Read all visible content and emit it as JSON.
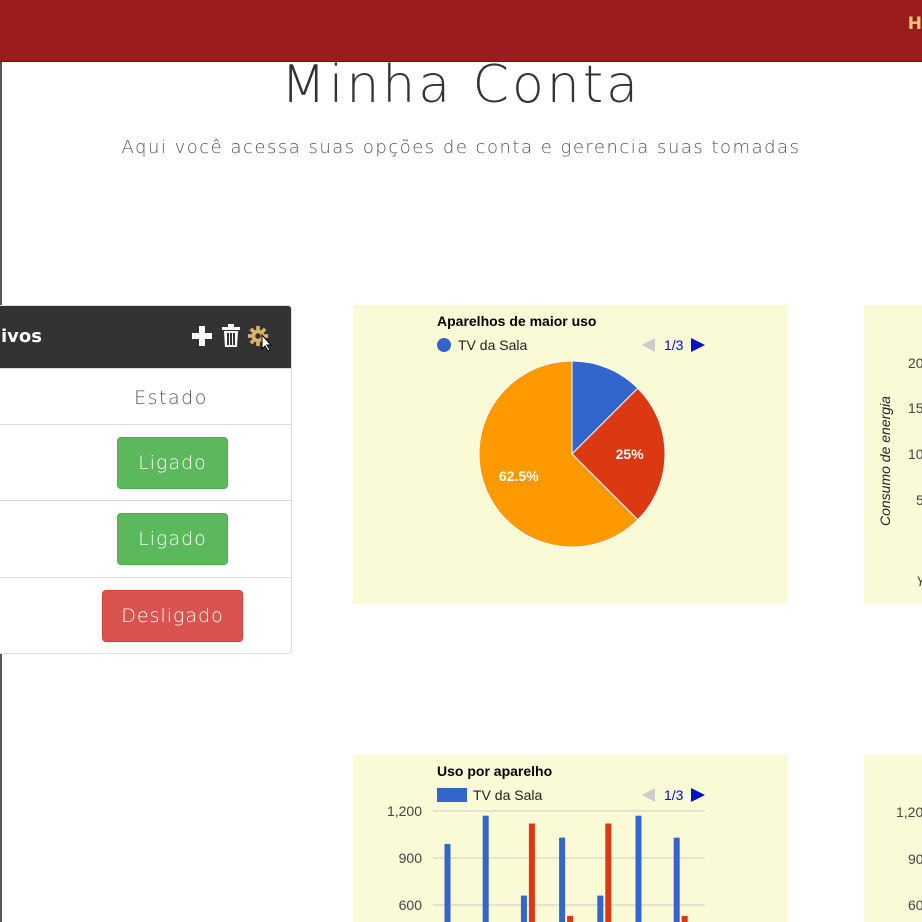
{
  "header": {
    "nav_text": "H"
  },
  "page": {
    "title": "Minha Conta",
    "subtitle": "Aqui você acessa suas opções de conta e gerencia suas tomadas"
  },
  "devices": {
    "title": "ivos",
    "column_state": "Estado",
    "rows": [
      {
        "state_label": "Ligado",
        "state": "on",
        "color": "#5cb85c"
      },
      {
        "state_label": "Ligado",
        "state": "on",
        "color": "#5cb85c"
      },
      {
        "state_label": "Desligado",
        "state": "off",
        "color": "#d9534f"
      }
    ],
    "icons": [
      "plus-icon",
      "trash-icon",
      "gear-icon"
    ]
  },
  "pie_card": {
    "legend": "TV da Sala",
    "pager": "1/3"
  },
  "energy_card": {
    "ylabel": "Consumo de energia",
    "ticks": [
      "20",
      "15",
      "10",
      "5"
    ],
    "bottom_text": "Y"
  },
  "bar_card": {
    "legend": "TV da Sala",
    "pager": "1/3"
  },
  "right_bottom_card": {
    "ticks": [
      "1,20",
      "90",
      "60"
    ]
  },
  "chart_data": [
    {
      "type": "pie",
      "title": "Aparelhos de maior uso",
      "categories": [
        "TV da Sala",
        "",
        ""
      ],
      "values": [
        12.5,
        25,
        62.5
      ],
      "data_labels": [
        "",
        "25%",
        "62.5%"
      ],
      "colors": [
        "#3366cc",
        "#dc3912",
        "#ff9900"
      ],
      "legend": "top-left"
    },
    {
      "type": "bar",
      "title": "Uso por aparelho",
      "ylim": [
        0,
        1200
      ],
      "yticks": [
        "1,200",
        "900",
        "600"
      ],
      "series": [
        {
          "name": "TV da Sala",
          "color": "#3366cc",
          "values": [
            990,
            1170,
            660,
            1030,
            660,
            1170,
            1030
          ]
        },
        {
          "name": "",
          "color": "#dc3912",
          "values": [
            0,
            0,
            1120,
            530,
            1120,
            0,
            530
          ]
        }
      ]
    }
  ]
}
